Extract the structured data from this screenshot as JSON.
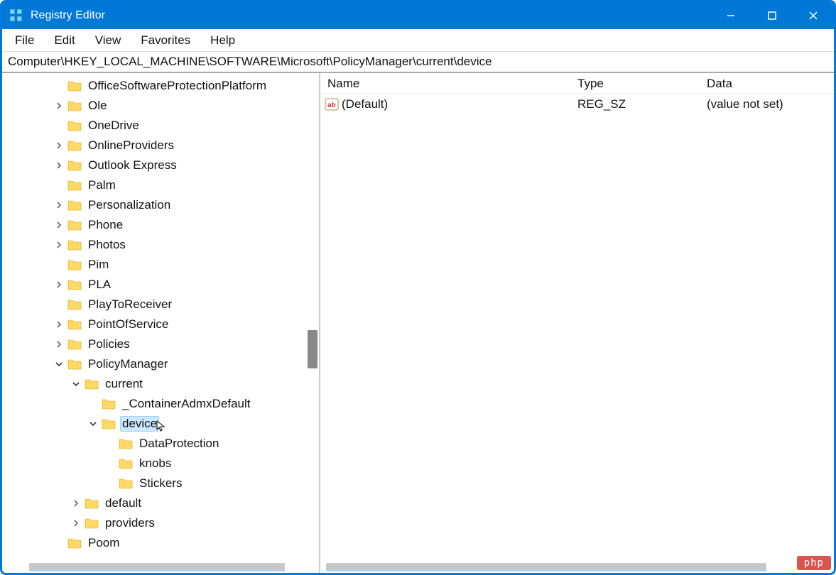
{
  "window": {
    "title": "Registry Editor"
  },
  "menu": {
    "file": "File",
    "edit": "Edit",
    "view": "View",
    "favorites": "Favorites",
    "help": "Help"
  },
  "address": "Computer\\HKEY_LOCAL_MACHINE\\SOFTWARE\\Microsoft\\PolicyManager\\current\\device",
  "tree": [
    {
      "indent": 3,
      "exp": "",
      "label": "OfficeSoftwareProtectionPlatform"
    },
    {
      "indent": 3,
      "exp": ">",
      "label": "Ole"
    },
    {
      "indent": 3,
      "exp": "",
      "label": "OneDrive"
    },
    {
      "indent": 3,
      "exp": ">",
      "label": "OnlineProviders"
    },
    {
      "indent": 3,
      "exp": ">",
      "label": "Outlook Express"
    },
    {
      "indent": 3,
      "exp": "",
      "label": "Palm"
    },
    {
      "indent": 3,
      "exp": ">",
      "label": "Personalization"
    },
    {
      "indent": 3,
      "exp": ">",
      "label": "Phone"
    },
    {
      "indent": 3,
      "exp": ">",
      "label": "Photos"
    },
    {
      "indent": 3,
      "exp": "",
      "label": "Pim"
    },
    {
      "indent": 3,
      "exp": ">",
      "label": "PLA"
    },
    {
      "indent": 3,
      "exp": "",
      "label": "PlayToReceiver"
    },
    {
      "indent": 3,
      "exp": ">",
      "label": "PointOfService"
    },
    {
      "indent": 3,
      "exp": ">",
      "label": "Policies"
    },
    {
      "indent": 3,
      "exp": "v",
      "label": "PolicyManager"
    },
    {
      "indent": 4,
      "exp": "v",
      "label": "current"
    },
    {
      "indent": 5,
      "exp": "",
      "label": "_ContainerAdmxDefault"
    },
    {
      "indent": 5,
      "exp": "v",
      "label": "device",
      "selected": true
    },
    {
      "indent": 6,
      "exp": "",
      "label": "DataProtection"
    },
    {
      "indent": 6,
      "exp": "",
      "label": "knobs"
    },
    {
      "indent": 6,
      "exp": "",
      "label": "Stickers"
    },
    {
      "indent": 4,
      "exp": ">",
      "label": "default"
    },
    {
      "indent": 4,
      "exp": ">",
      "label": "providers"
    },
    {
      "indent": 3,
      "exp": "",
      "label": "Poom"
    }
  ],
  "columns": {
    "name": "Name",
    "type": "Type",
    "data": "Data"
  },
  "values": [
    {
      "name": "(Default)",
      "type": "REG_SZ",
      "data": "(value not set)"
    }
  ],
  "watermark": "php"
}
